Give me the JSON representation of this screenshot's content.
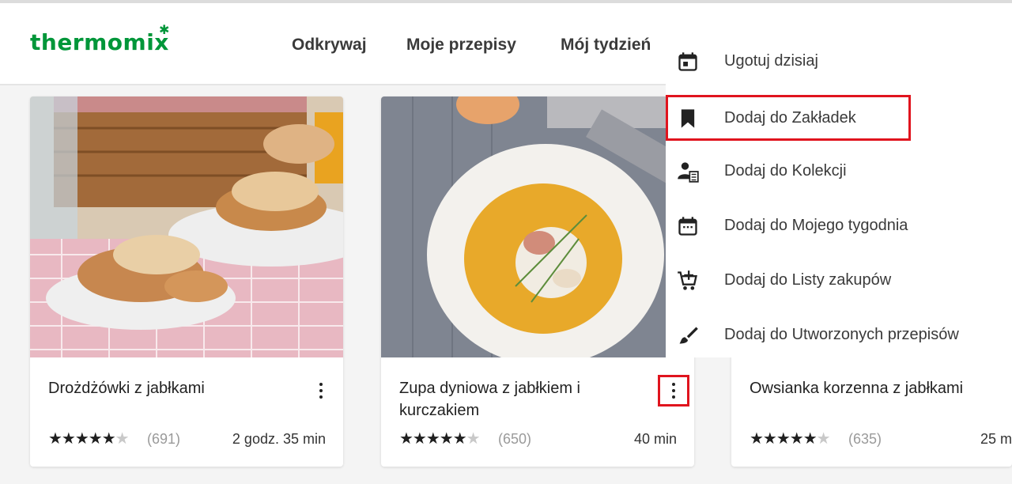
{
  "header": {
    "logo": "thermomix",
    "nav": [
      "Odkrywaj",
      "Moje przepisy",
      "Mój tydzień"
    ]
  },
  "cards": [
    {
      "title": "Drożdżówki z jabłkami",
      "rating": 4.5,
      "rating_count": "(691)",
      "time": "2 godz. 35 min",
      "image": "pastry-photo"
    },
    {
      "title": "Zupa dyniowa z jabłkiem i kurczakiem",
      "rating": 4.5,
      "rating_count": "(650)",
      "time": "40 min",
      "image": "soup-photo"
    },
    {
      "title": "Owsianka korzenna z jabłkami",
      "rating": 4.5,
      "rating_count": "(635)",
      "time": "25 m",
      "image": "oatmeal-photo"
    }
  ],
  "menu": {
    "items": [
      {
        "label": "Ugotuj dzisiaj",
        "icon": "calendar-today-icon"
      },
      {
        "label": "Dodaj do Zakładek",
        "icon": "bookmark-icon"
      },
      {
        "label": "Dodaj do Kolekcji",
        "icon": "collection-icon"
      },
      {
        "label": "Dodaj do Mojego tygodnia",
        "icon": "calendar-week-icon"
      },
      {
        "label": "Dodaj do Listy zakupów",
        "icon": "cart-add-icon"
      },
      {
        "label": "Dodaj do Utworzonych przepisów",
        "icon": "brush-icon"
      }
    ]
  },
  "colors": {
    "brand": "#009639",
    "highlight": "#e0141e"
  }
}
